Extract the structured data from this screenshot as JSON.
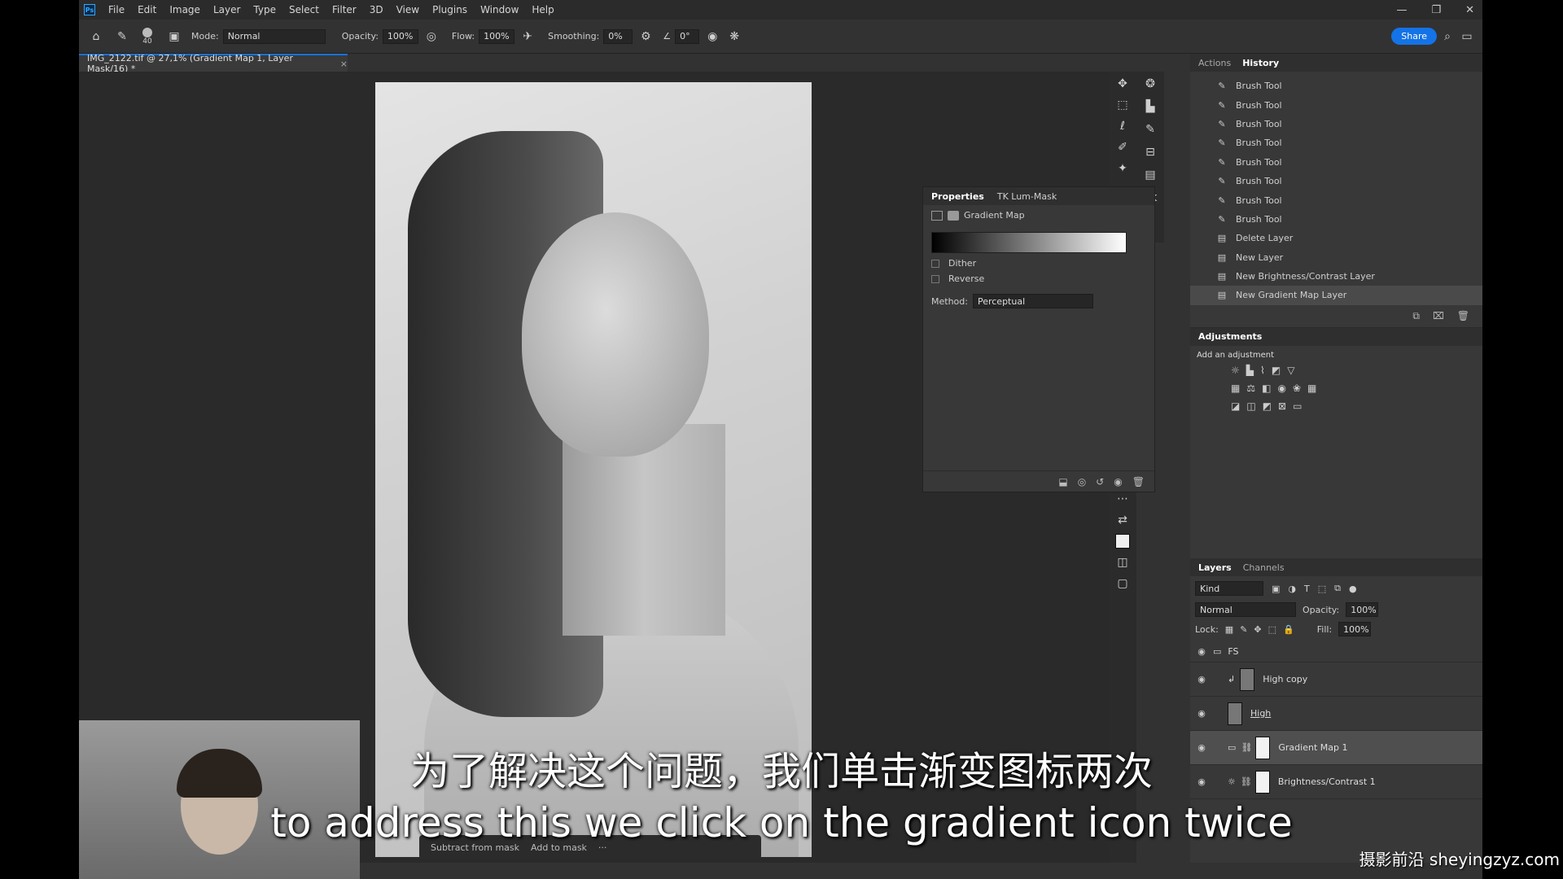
{
  "menubar": {
    "logo": "Ps",
    "items": [
      "File",
      "Edit",
      "Image",
      "Layer",
      "Type",
      "Select",
      "Filter",
      "3D",
      "View",
      "Plugins",
      "Window",
      "Help"
    ],
    "win_min": "—",
    "win_restore": "❐",
    "win_close": "✕"
  },
  "options": {
    "brush_size": "40",
    "mode_label": "Mode:",
    "mode_value": "Normal",
    "opacity_label": "Opacity:",
    "opacity_value": "100%",
    "flow_label": "Flow:",
    "flow_value": "100%",
    "smoothing_label": "Smoothing:",
    "smoothing_value": "0%",
    "angle_value": "0°",
    "share_label": "Share"
  },
  "document": {
    "tab_title": "IMG_2122.tif @ 27,1% (Gradient Map 1, Layer Mask/16) *",
    "close": "×"
  },
  "mask_bar": {
    "subtract": "Subtract from mask",
    "add": "Add to mask",
    "more": "···"
  },
  "properties": {
    "tabs": [
      "Properties",
      "TK Lum-Mask"
    ],
    "header": "Gradient Map",
    "dither": "Dither",
    "reverse": "Reverse",
    "method_label": "Method:",
    "method_value": "Perceptual"
  },
  "history_panel": {
    "tabs": [
      "Actions",
      "History"
    ],
    "items": [
      "Brush Tool",
      "Brush Tool",
      "Brush Tool",
      "Brush Tool",
      "Brush Tool",
      "Brush Tool",
      "Brush Tool",
      "Brush Tool",
      "Delete Layer",
      "New Layer",
      "New Brightness/Contrast Layer",
      "New Gradient Map Layer"
    ]
  },
  "adjustments_panel": {
    "title": "Adjustments",
    "subtitle": "Add an adjustment"
  },
  "layers_panel": {
    "tabs": [
      "Layers",
      "Channels"
    ],
    "kind_label": "Kind",
    "blend_mode": "Normal",
    "opacity_label": "Opacity:",
    "opacity_value": "100%",
    "lock_label": "Lock:",
    "fill_label": "Fill:",
    "fill_value": "100%",
    "layers": [
      {
        "name": "FS"
      },
      {
        "name": "High copy"
      },
      {
        "name": "High"
      },
      {
        "name": "Gradient Map 1"
      },
      {
        "name": "Brightness/Contrast 1"
      }
    ]
  },
  "subtitles": {
    "chinese": "为了解决这个问题，我们单击渐变图标两次",
    "english": "to address this we click on the gradient icon twice"
  },
  "watermark": "摄影前沿 sheyingzyz.com"
}
